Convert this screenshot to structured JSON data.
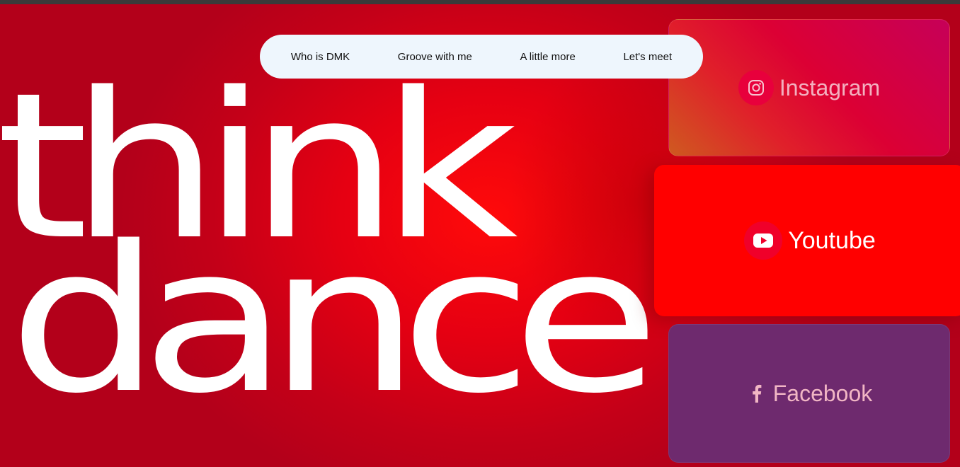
{
  "hero": {
    "line1": "think",
    "line2": "dance"
  },
  "nav": {
    "items": [
      {
        "label": "Who is DMK"
      },
      {
        "label": "Groove with me"
      },
      {
        "label": "A little more"
      },
      {
        "label": "Let's meet"
      }
    ]
  },
  "socials": {
    "instagram": {
      "label": "Instagram",
      "icon": "instagram-icon",
      "color": "#d9002f"
    },
    "youtube": {
      "label": "Youtube",
      "icon": "youtube-icon",
      "color": "#ff0000"
    },
    "facebook": {
      "label": "Facebook",
      "icon": "facebook-icon",
      "color": "#6e2a6e"
    }
  },
  "colors": {
    "background": "#e0000f",
    "nav_background": "#eef6fd",
    "hero_text": "#ffffff"
  }
}
